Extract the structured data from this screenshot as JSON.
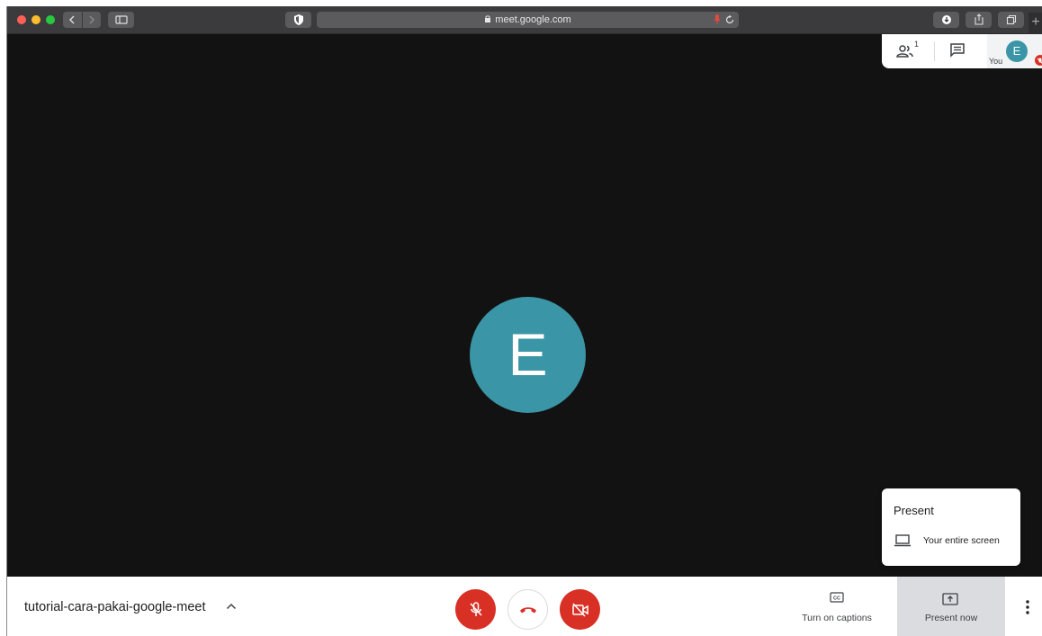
{
  "browser": {
    "url": "meet.google.com",
    "new_tab": "+"
  },
  "meet": {
    "people_count": "1",
    "self_label": "You",
    "self_initial": "E",
    "main_initial": "E",
    "meeting_name": "tutorial-cara-pakai-google-meet",
    "present_popup": {
      "title": "Present",
      "option": "Your entire screen"
    },
    "captions_label": "Turn on captions",
    "present_label": "Present now"
  },
  "colors": {
    "avatar": "#3a95a6",
    "danger": "#d93025",
    "background": "#121212"
  },
  "icons": [
    "shield-icon",
    "lock-icon",
    "mic-recording-icon",
    "reload-icon",
    "download-icon",
    "share-icon",
    "tabs-icon",
    "people-icon",
    "chat-icon",
    "mic-off-icon",
    "hangup-icon",
    "camera-off-icon",
    "captions-icon",
    "present-icon",
    "more-vert-icon",
    "laptop-icon"
  ]
}
